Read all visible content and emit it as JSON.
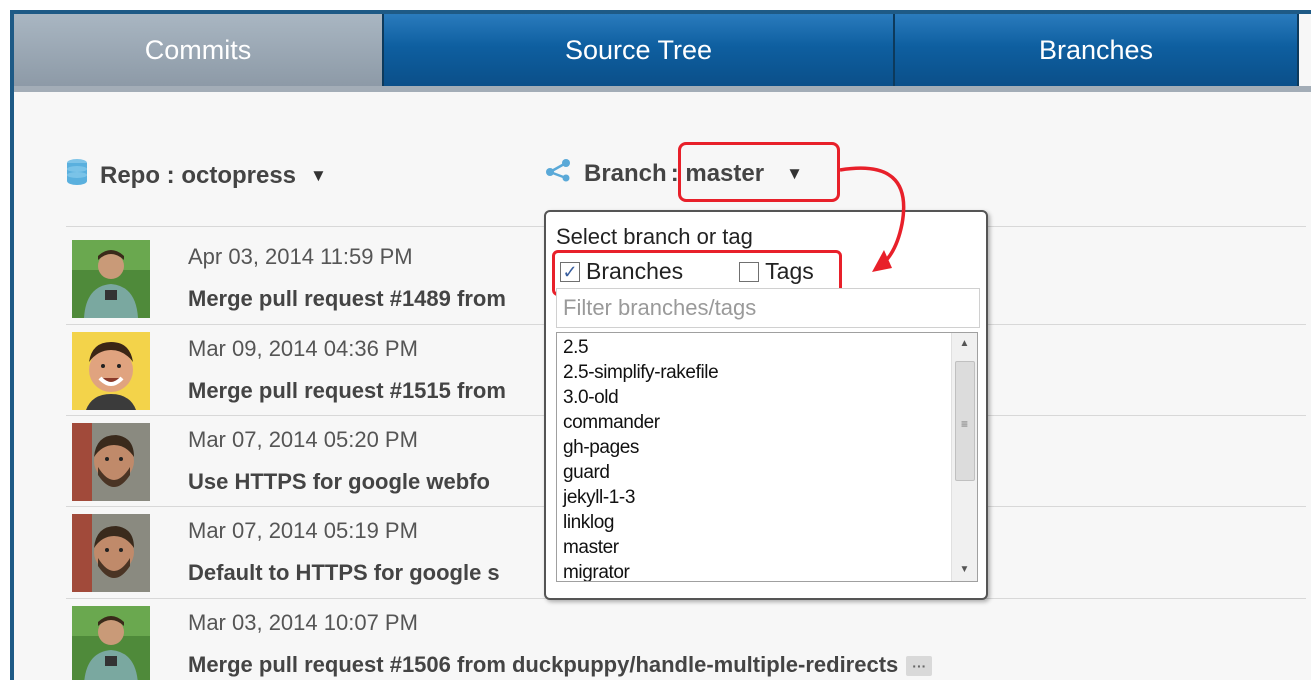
{
  "tabs": [
    {
      "label": "Commits",
      "active": true
    },
    {
      "label": "Source Tree",
      "active": false
    },
    {
      "label": "Branches",
      "active": false
    }
  ],
  "toolbar": {
    "repo_label": "Repo : octopress",
    "branch_prefix": "Branch",
    "branch_value": ": master",
    "dropdown_indicator": "▼"
  },
  "dropdown": {
    "title": "Select branch or tag",
    "branches_label": "Branches",
    "branches_checked": true,
    "tags_label": "Tags",
    "tags_checked": false,
    "filter_placeholder": "Filter branches/tags",
    "items": [
      "2.5",
      "2.5-simplify-rakefile",
      "3.0-old",
      "commander",
      "gh-pages",
      "guard",
      "jekyll-1-3",
      "linklog",
      "master",
      "migrator"
    ]
  },
  "commits": [
    {
      "date": "Apr 03, 2014 11:59 PM",
      "message": "Merge pull request #1489 from"
    },
    {
      "date": "Mar 09, 2014 04:36 PM",
      "message": "Merge pull request #1515 from"
    },
    {
      "date": "Mar 07, 2014 05:20 PM",
      "message": "Use HTTPS for google webfo"
    },
    {
      "date": "Mar 07, 2014 05:19 PM",
      "message": "Default to HTTPS for google s"
    },
    {
      "date": "Mar 03, 2014 10:07 PM",
      "message": "Merge pull request #1506 from duckpuppy/handle-multiple-redirects",
      "more": "···"
    }
  ],
  "colors": {
    "tab_blue": "#0e5fa0",
    "tab_active": "#9aa6b2",
    "annotation_red": "#e8202a"
  }
}
